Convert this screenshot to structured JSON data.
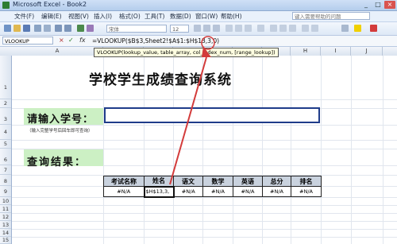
{
  "window": {
    "title": "Microsoft Excel - Book2",
    "minimize": "_",
    "restore": "□",
    "close": "×"
  },
  "menu": {
    "items": [
      "文件(F)",
      "编辑(E)",
      "视图(V)",
      "插入(I)",
      "格式(O)",
      "工具(T)",
      "数据(D)",
      "窗口(W)",
      "帮助(H)"
    ],
    "help_placeholder": "键入需要帮助的问题"
  },
  "toolbar": {
    "font": "宋体",
    "size": "12"
  },
  "formula_bar": {
    "name_box": "VLOOKUP",
    "cancel": "×",
    "confirm": "✓",
    "fx": "fx",
    "formula": "=VLOOKUP($B$3,Sheet2!$A$1:$H$13,3,0)"
  },
  "tooltip": "VLOOKUP(lookup_value, table_array, col_index_num, [range_lookup])",
  "columns": [
    "A",
    "B",
    "C",
    "D",
    "E",
    "F",
    "G",
    "H",
    "I",
    "J"
  ],
  "rows": [
    "1",
    "2",
    "3",
    "4",
    "5",
    "6",
    "7",
    "8",
    "9",
    "10",
    "11",
    "12",
    "13",
    "14",
    "15"
  ],
  "sheet": {
    "title": "学校学生成绩查询系统",
    "prompt": "请输入学号：",
    "hint": "（输入完整学号后回车即可查询）",
    "result_label": "查询结果："
  },
  "table": {
    "headers": [
      "考试名称",
      "姓名",
      "语文",
      "数学",
      "英语",
      "总分",
      "排名"
    ],
    "values": [
      "#N/A",
      "$H$13,3,",
      "#N/A",
      "#N/A",
      "#N/A",
      "#N/A",
      "#N/A"
    ]
  },
  "colors": {
    "accent": "#d33b3b",
    "green_fill": "#ccf0c4",
    "header_fill": "#c9d2de"
  }
}
